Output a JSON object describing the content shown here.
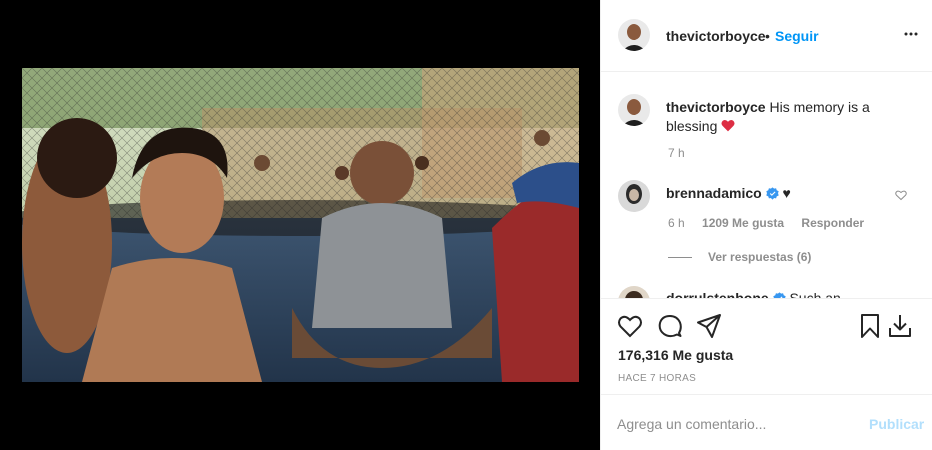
{
  "post": {
    "author": "thevictorboyce",
    "follow_separator": "•",
    "follow_label": "Seguir",
    "more_icon": "more-horizontal-icon"
  },
  "caption": {
    "username": "thevictorboyce",
    "text": "His memory is a blessing",
    "emoji": "❤️",
    "time": "7 h"
  },
  "comments": [
    {
      "username": "brennadamico",
      "verified": true,
      "text": "♥",
      "time": "6 h",
      "likes": "1209 Me gusta",
      "reply_label": "Responder",
      "view_replies": "Ver respuestas (6)"
    },
    {
      "username": "dorrulstenbone",
      "verified": true,
      "text": "Such an"
    }
  ],
  "actions": {
    "likes": "176,316 Me gusta",
    "posted_ago": "HACE 7 HORAS"
  },
  "add_comment": {
    "placeholder": "Agrega un comentario...",
    "post_label": "Publicar"
  },
  "colors": {
    "link_blue": "#0095f6",
    "post_disabled": "#b2dffc",
    "secondary_text": "#8e8e8e",
    "verified_blue": "#3897f0",
    "heart_red": "#ed4956"
  }
}
